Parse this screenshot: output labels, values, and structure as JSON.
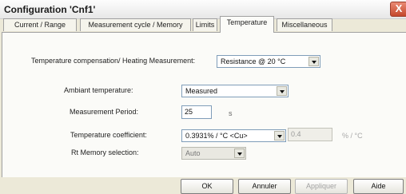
{
  "window": {
    "title": "Configuration 'Cnf1'",
    "close_glyph": "X"
  },
  "tabs": [
    {
      "label": "Current / Range",
      "active": false
    },
    {
      "label": "Measurement cycle / Memory",
      "active": false
    },
    {
      "label": "Limits",
      "active": false
    },
    {
      "label": "Temperature",
      "active": true
    },
    {
      "label": "Miscellaneous",
      "active": false
    }
  ],
  "temperature": {
    "compensation_label": "Temperature compensation/ Heating Measurement:",
    "compensation_value": "Resistance @ 20 °C",
    "ambient_label": "Ambiant temperature:",
    "ambient_value": "Measured",
    "period_label": "Measurement Period:",
    "period_value": "25",
    "period_unit": "s",
    "coefficient_label": "Temperature coefficient:",
    "coefficient_value": "0.3931% / °C  <Cu>",
    "coefficient_custom_value": "0.4",
    "coefficient_unit": "% / °C",
    "rt_memory_label": "Rt Memory selection:",
    "rt_memory_value": "Auto"
  },
  "buttons": {
    "ok": "OK",
    "cancel": "Annuler",
    "apply": "Appliquer",
    "help": "Aide"
  }
}
